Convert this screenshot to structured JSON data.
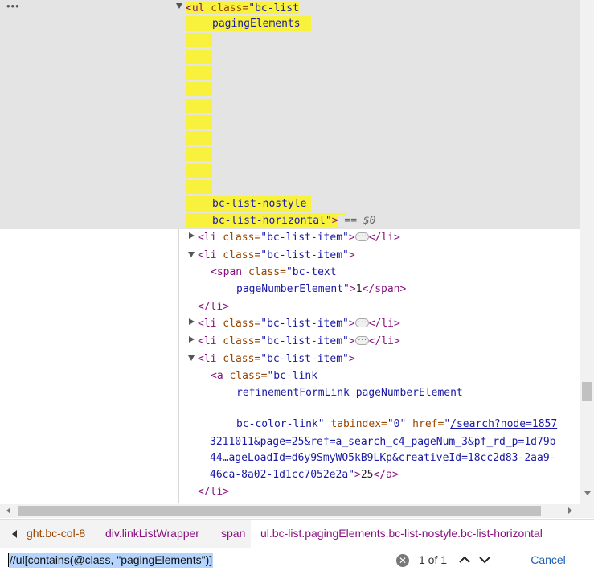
{
  "toolbar": {
    "overflow_glyph": "•••"
  },
  "elements_tree": {
    "ul_open": {
      "tag_name": "<ul",
      "class_attr": " class=",
      "class_line1": "\"bc-list",
      "class_line2": "pagingElements",
      "class_line3": "bc-list-nostyle",
      "class_line4": "bc-list-horizontal\"",
      "close": ">",
      "selected_marker": " == $0"
    },
    "li_collapsed_1": {
      "open": "<li",
      "attr": " class=",
      "val": "\"bc-list-item\"",
      "gt": ">",
      "close": "</li>"
    },
    "li_expanded_1": {
      "open": "<li",
      "attr": " class=",
      "val": "\"bc-list-item\"",
      "gt": ">"
    },
    "span": {
      "open": "<span",
      "attr": " class=",
      "val_line1": "\"bc-text",
      "val_line2": "pageNumberElement\"",
      "gt": ">",
      "text": "1",
      "close": "</span>"
    },
    "li_close_1": "</li>",
    "li_collapsed_2": {
      "open": "<li",
      "attr": " class=",
      "val": "\"bc-list-item\"",
      "gt": ">",
      "close": "</li>"
    },
    "li_collapsed_3": {
      "open": "<li",
      "attr": " class=",
      "val": "\"bc-list-item\"",
      "gt": ">",
      "close": "</li>"
    },
    "li_expanded_2": {
      "open": "<li",
      "attr": " class=",
      "val": "\"bc-list-item\"",
      "gt": ">"
    },
    "anchor": {
      "open": "<a",
      "attr_class": " class=",
      "class_line1": "\"bc-link",
      "class_line2": "refinementFormLink pageNumberElement",
      "class_line3": "bc-color-link\"",
      "attr_tabindex": " tabindex=",
      "tabindex_val": "\"0\"",
      "attr_href": " href=",
      "href_quote": "\"",
      "href_line1": "/search?node=1857",
      "href_line2": "3211011&page=25&ref=a_search_c4_pageNum_3&pf_rd_p=1d79b",
      "href_line3": "44…ageLoadId=d6y9SmyWO5kB9LKp&creativeId=18cc2d83-2aa9-",
      "href_line4": "46ca-8a02-1d1cc7052e2a",
      "href_end": "\"",
      "gt": ">",
      "text": "25",
      "close": "</a>"
    },
    "li_close_2": "</li>",
    "ellipsis_badge": "···"
  },
  "breadcrumbs": {
    "items": [
      "ght.bc-col-8",
      "div.linkListWrapper",
      "span",
      "ul.bc-list.pagingElements.bc-list-nostyle.bc-list-horizontal"
    ],
    "colors": {
      "element": "#881280",
      "class": "#994500"
    }
  },
  "search": {
    "value": "//ul[contains(@class, \"pagingElements\")]",
    "clear_glyph": "✕",
    "match_count": "1 of 1",
    "prev_glyph": "⌃",
    "next_glyph": "⌄",
    "cancel_label": "Cancel"
  },
  "colors": {
    "highlight": "#f9f23d",
    "selection_background": "#e4e4e4",
    "tag": "#881280",
    "attribute": "#994500",
    "value": "#1a1aa6"
  }
}
